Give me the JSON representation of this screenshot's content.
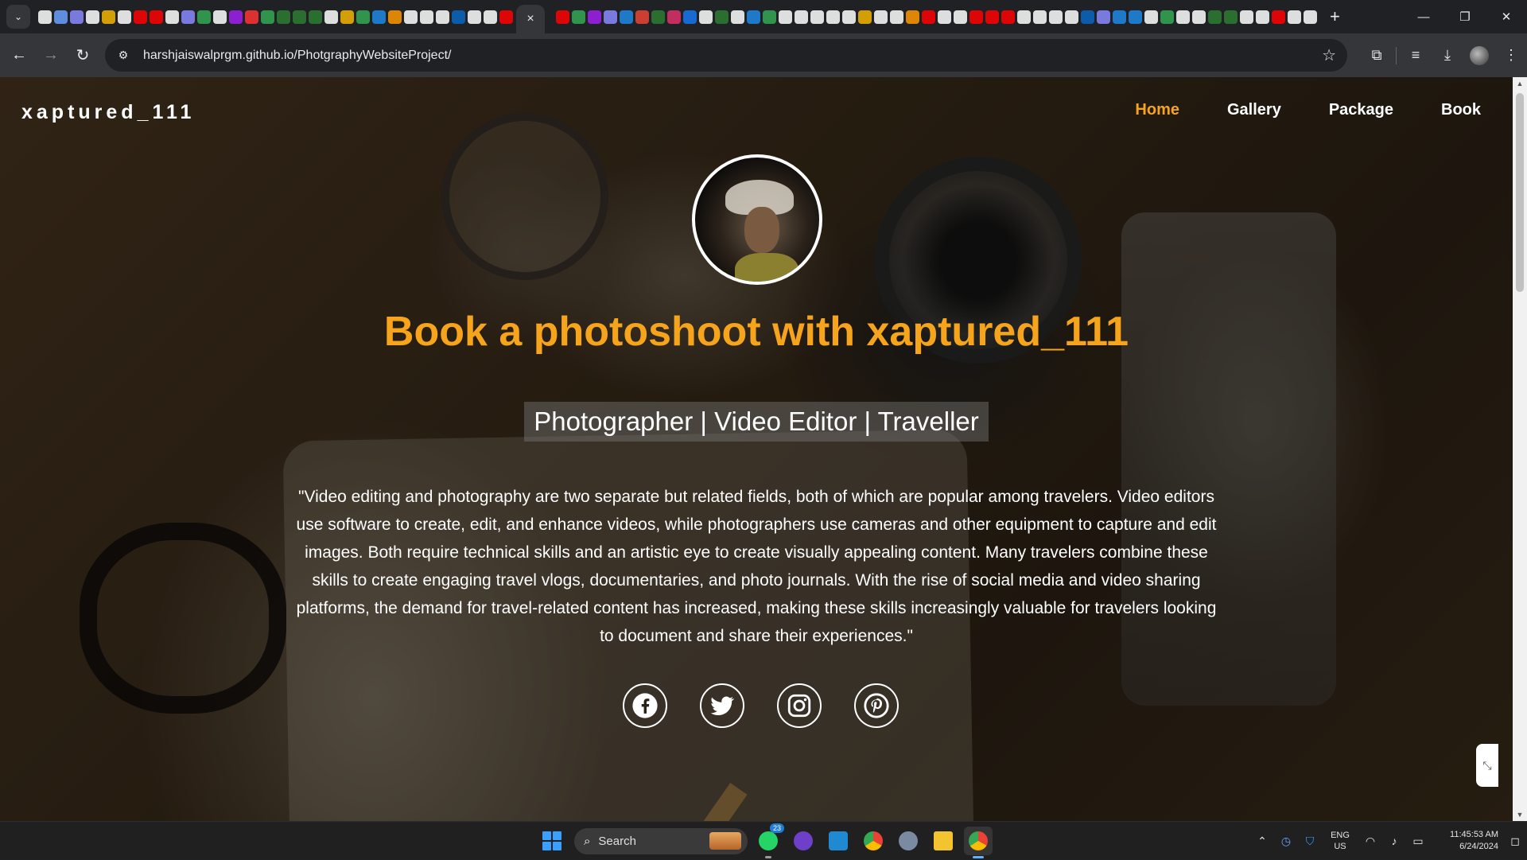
{
  "browser": {
    "tab_favicon_colors": [
      "#ffffff",
      "#6aa0ff",
      "#8a8aff",
      "#ffffff",
      "#f4b400",
      "#ffffff",
      "#ff0000",
      "#ff0000",
      "#ffffff",
      "#8a8aff",
      "#34a853",
      "#ffffff",
      "#a020f0",
      "#ff3333",
      "#34a853",
      "#2e7d32",
      "#2e7d32",
      "#2e7d32",
      "#ffffff",
      "#f4b400",
      "#34a853",
      "#1e88e5",
      "#ff9800",
      "#ffffff",
      "#ffffff",
      "#ffffff",
      "#0a66c2",
      "#ffffff",
      "#ffffff",
      "#ff0000"
    ],
    "tab_favicon_colors_after": [
      "#ff0000",
      "#34a853",
      "#a020f0",
      "#8a8aff",
      "#1e88e5",
      "#ea4335",
      "#2e7d32",
      "#e1306c",
      "#1877f2",
      "#ffffff",
      "#2e7d32",
      "#ffffff",
      "#1e88e5",
      "#34a853",
      "#ffffff",
      "#ffffff",
      "#ffffff",
      "#ffffff",
      "#ffffff",
      "#f4b400",
      "#ffffff",
      "#ffffff",
      "#ff9800",
      "#ff0000",
      "#ffffff",
      "#ffffff",
      "#ff0000",
      "#ff0000",
      "#ff0000",
      "#ffffff",
      "#ffffff",
      "#ffffff",
      "#ffffff",
      "#0a66c2",
      "#8a8aff",
      "#1e88e5",
      "#1e88e5",
      "#ffffff",
      "#34a853",
      "#ffffff",
      "#ffffff",
      "#2e7d32",
      "#2e7d32",
      "#ffffff",
      "#ffffff",
      "#ff0000",
      "#ffffff",
      "#ffffff"
    ],
    "active_tab_close": "×",
    "new_tab": "+",
    "window_controls": {
      "minimize": "—",
      "maximize": "❐",
      "close": "✕"
    },
    "toolbar": {
      "back": "←",
      "forward": "→",
      "reload": "↻",
      "site_info": "⚙",
      "url": "harshjaiswalprgm.github.io/PhotgraphyWebsiteProject/",
      "bookmark": "☆",
      "extensions": "⧉",
      "reading_list": "≡",
      "downloads": "⤓",
      "menu": "⋮"
    }
  },
  "site": {
    "brand": "xaptured_111",
    "nav": [
      {
        "label": "Home",
        "active": true
      },
      {
        "label": "Gallery",
        "active": false
      },
      {
        "label": "Package",
        "active": false
      },
      {
        "label": "Book",
        "active": false
      }
    ],
    "accent_color": "#f5a41b",
    "headline": "Book a photoshoot with xaptured_111",
    "tagline": "Photographer | Video Editor | Traveller",
    "quote": "\"Video editing and photography are two separate but related fields, both of which are popular among travelers. Video editors use software to create, edit, and enhance videos, while photographers use cameras and other equipment to capture and edit images. Both require technical skills and an artistic eye to create visually appealing content. Many travelers combine these skills to create engaging travel vlogs, documentaries, and photo journals. With the rise of social media and video sharing platforms, the demand for travel-related content has increased, making these skills increasingly valuable for travelers looking to document and share their experiences.\"",
    "socials": [
      "facebook-icon",
      "twitter-icon",
      "instagram-icon",
      "pinterest-icon"
    ]
  },
  "taskbar": {
    "search_label": "Search",
    "whatsapp_badge": "23",
    "apps": [
      "whatsapp-icon",
      "github-desktop-icon",
      "vscode-icon",
      "chrome-icon",
      "settings-icon",
      "file-explorer-icon",
      "chrome-active-icon"
    ],
    "tray": {
      "lang_line1": "ENG",
      "lang_line2": "US",
      "time": "11:45:53 AM",
      "date": "6/24/2024"
    }
  }
}
